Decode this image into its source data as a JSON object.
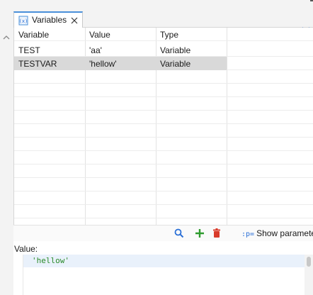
{
  "tab": {
    "label": "Variables",
    "icon": "variables-icon"
  },
  "table": {
    "headers": [
      "Variable",
      "Value",
      "Type"
    ],
    "rows": [
      {
        "variable": "TEST",
        "value": "'aa'",
        "type": "Variable"
      },
      {
        "variable": "TESTVAR",
        "value": "'hellow'",
        "type": "Variable",
        "selected": true
      }
    ]
  },
  "toolbar": {
    "icons": [
      "search-icon",
      "add-icon",
      "delete-icon"
    ],
    "show_parameters_prefix": ":p=",
    "show_parameters_label": "Show parameters"
  },
  "value_panel": {
    "label": "Value:",
    "text": "'hellow'"
  },
  "colors": {
    "accent": "#2a6fd6",
    "add": "#2e9b2e",
    "delete": "#d93b2b",
    "value_text": "#2a8a2a",
    "selection": "#d9d9d9"
  }
}
